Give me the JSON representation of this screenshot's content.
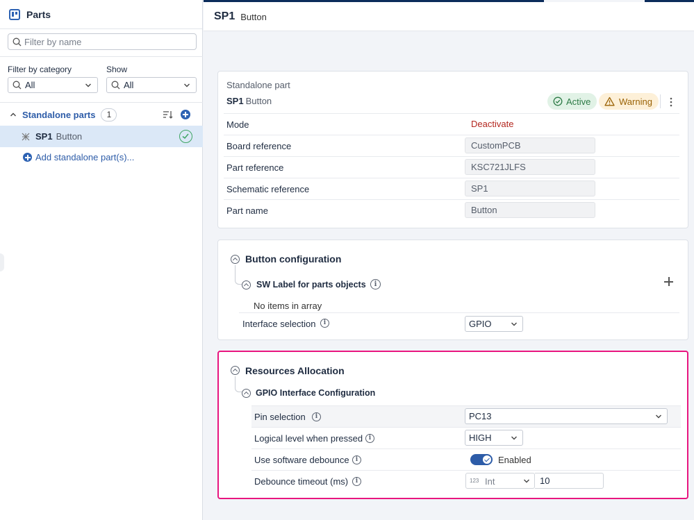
{
  "sidebar": {
    "title": "Parts",
    "filter_placeholder": "Filter by name",
    "category_label": "Filter by category",
    "category_value": "All",
    "show_label": "Show",
    "show_value": "All",
    "group_label": "Standalone parts",
    "group_count": "1",
    "item_name": "SP1",
    "item_type": "Button",
    "add_label": "Add standalone part(s)..."
  },
  "header": {
    "name": "SP1",
    "type": "Button"
  },
  "part_card": {
    "kind": "Standalone part",
    "name": "SP1",
    "type": "Button",
    "status_active": "Active",
    "status_warning": "Warning",
    "rows": [
      {
        "label": "Mode",
        "value": "Deactivate"
      },
      {
        "label": "Board reference",
        "value": "CustomPCB"
      },
      {
        "label": "Part reference",
        "value": "KSC721JLFS"
      },
      {
        "label": "Schematic reference",
        "value": "SP1"
      },
      {
        "label": "Part name",
        "value": "Button"
      }
    ]
  },
  "button_config": {
    "title": "Button configuration",
    "sw_label_title": "SW Label for parts objects",
    "no_items": "No items in array",
    "interface_label": "Interface selection",
    "interface_value": "GPIO"
  },
  "resources": {
    "title": "Resources Allocation",
    "subtitle": "GPIO Interface Configuration",
    "pin_label": "Pin selection",
    "pin_value": "PC13",
    "level_label": "Logical level when pressed",
    "level_value": "HIGH",
    "debounce_label": "Use software debounce",
    "debounce_enabled": true,
    "debounce_state_text": "Enabled",
    "timeout_label": "Debounce timeout (ms)",
    "timeout_type_tag": "123",
    "timeout_type": "Int",
    "timeout_value": "10"
  },
  "colors": {
    "accent": "#2d5ca8",
    "highlight_border": "#e8157f",
    "active": "#2c7a45",
    "warning": "#9a6205",
    "deactivate": "#b3261e"
  },
  "icons": [
    "parts-icon",
    "search-icon",
    "chevron-down-icon",
    "sort-icon",
    "plus-circle-icon",
    "component-icon",
    "check-circle-icon",
    "check-icon",
    "warning-icon",
    "kebab-icon",
    "collapse-icon",
    "info-icon",
    "plus-icon"
  ]
}
